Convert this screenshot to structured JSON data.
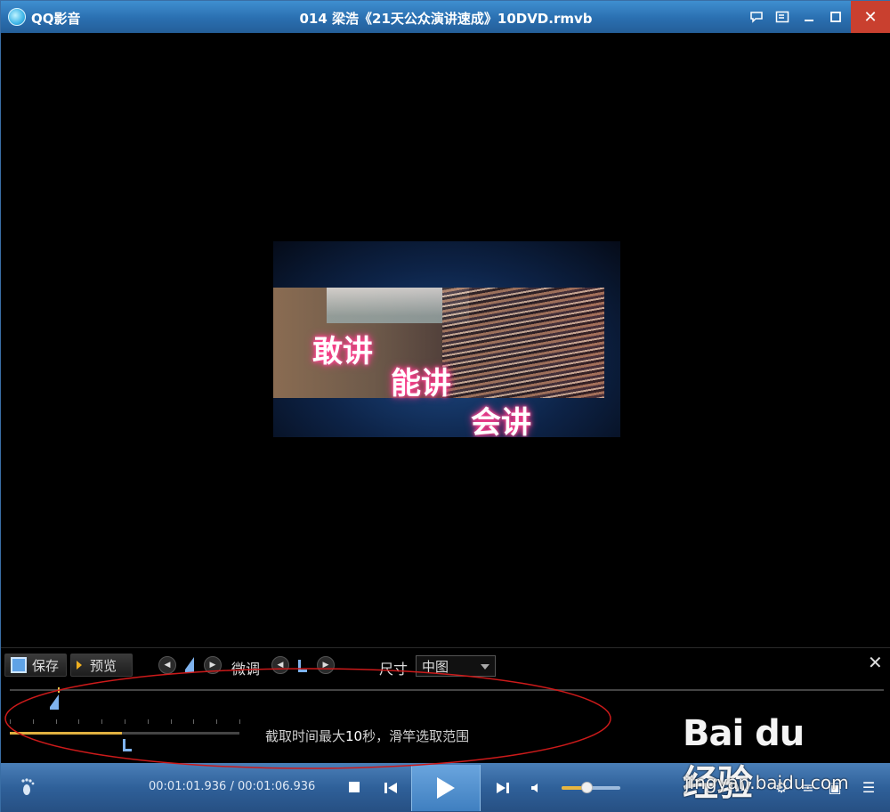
{
  "window": {
    "app_name": "QQ影音",
    "file_title": "014 梁浩《21天公众演讲速成》10DVD.rmvb",
    "close_glyph": "✕"
  },
  "video": {
    "slogan_1": "敢讲",
    "slogan_2": "能讲",
    "slogan_3": "会讲"
  },
  "capture_panel": {
    "save_label": "保存",
    "preview_label": "预览",
    "fine_tune_label": "微调",
    "size_label": "尺寸",
    "size_value": "中图",
    "hint_prefix": "截取时间最大",
    "hint_number": "10",
    "hint_suffix": "秒，滑竿选取范围",
    "selection_fraction": 0.49
  },
  "controls": {
    "time_display": "00:01:01.936 / 00:01:06.936",
    "volume_fraction": 0.42
  },
  "watermark": {
    "logo_text": "Bai du 经验",
    "url": "jingyan.baidu.com"
  },
  "colors": {
    "titlebar": "#2a6fb0",
    "accent_yellow": "#e0b040",
    "annotation_red": "#cc1a1a",
    "close_red": "#c9402f"
  },
  "icons": [
    "app-logo-icon",
    "feedback-icon",
    "playlist-icon",
    "minimize-icon",
    "maximize-icon",
    "close-icon",
    "save-icon",
    "play-triangle-icon",
    "footprint-icon",
    "stop-icon",
    "prev-icon",
    "play-icon",
    "next-icon",
    "volume-icon",
    "settings-icon"
  ]
}
